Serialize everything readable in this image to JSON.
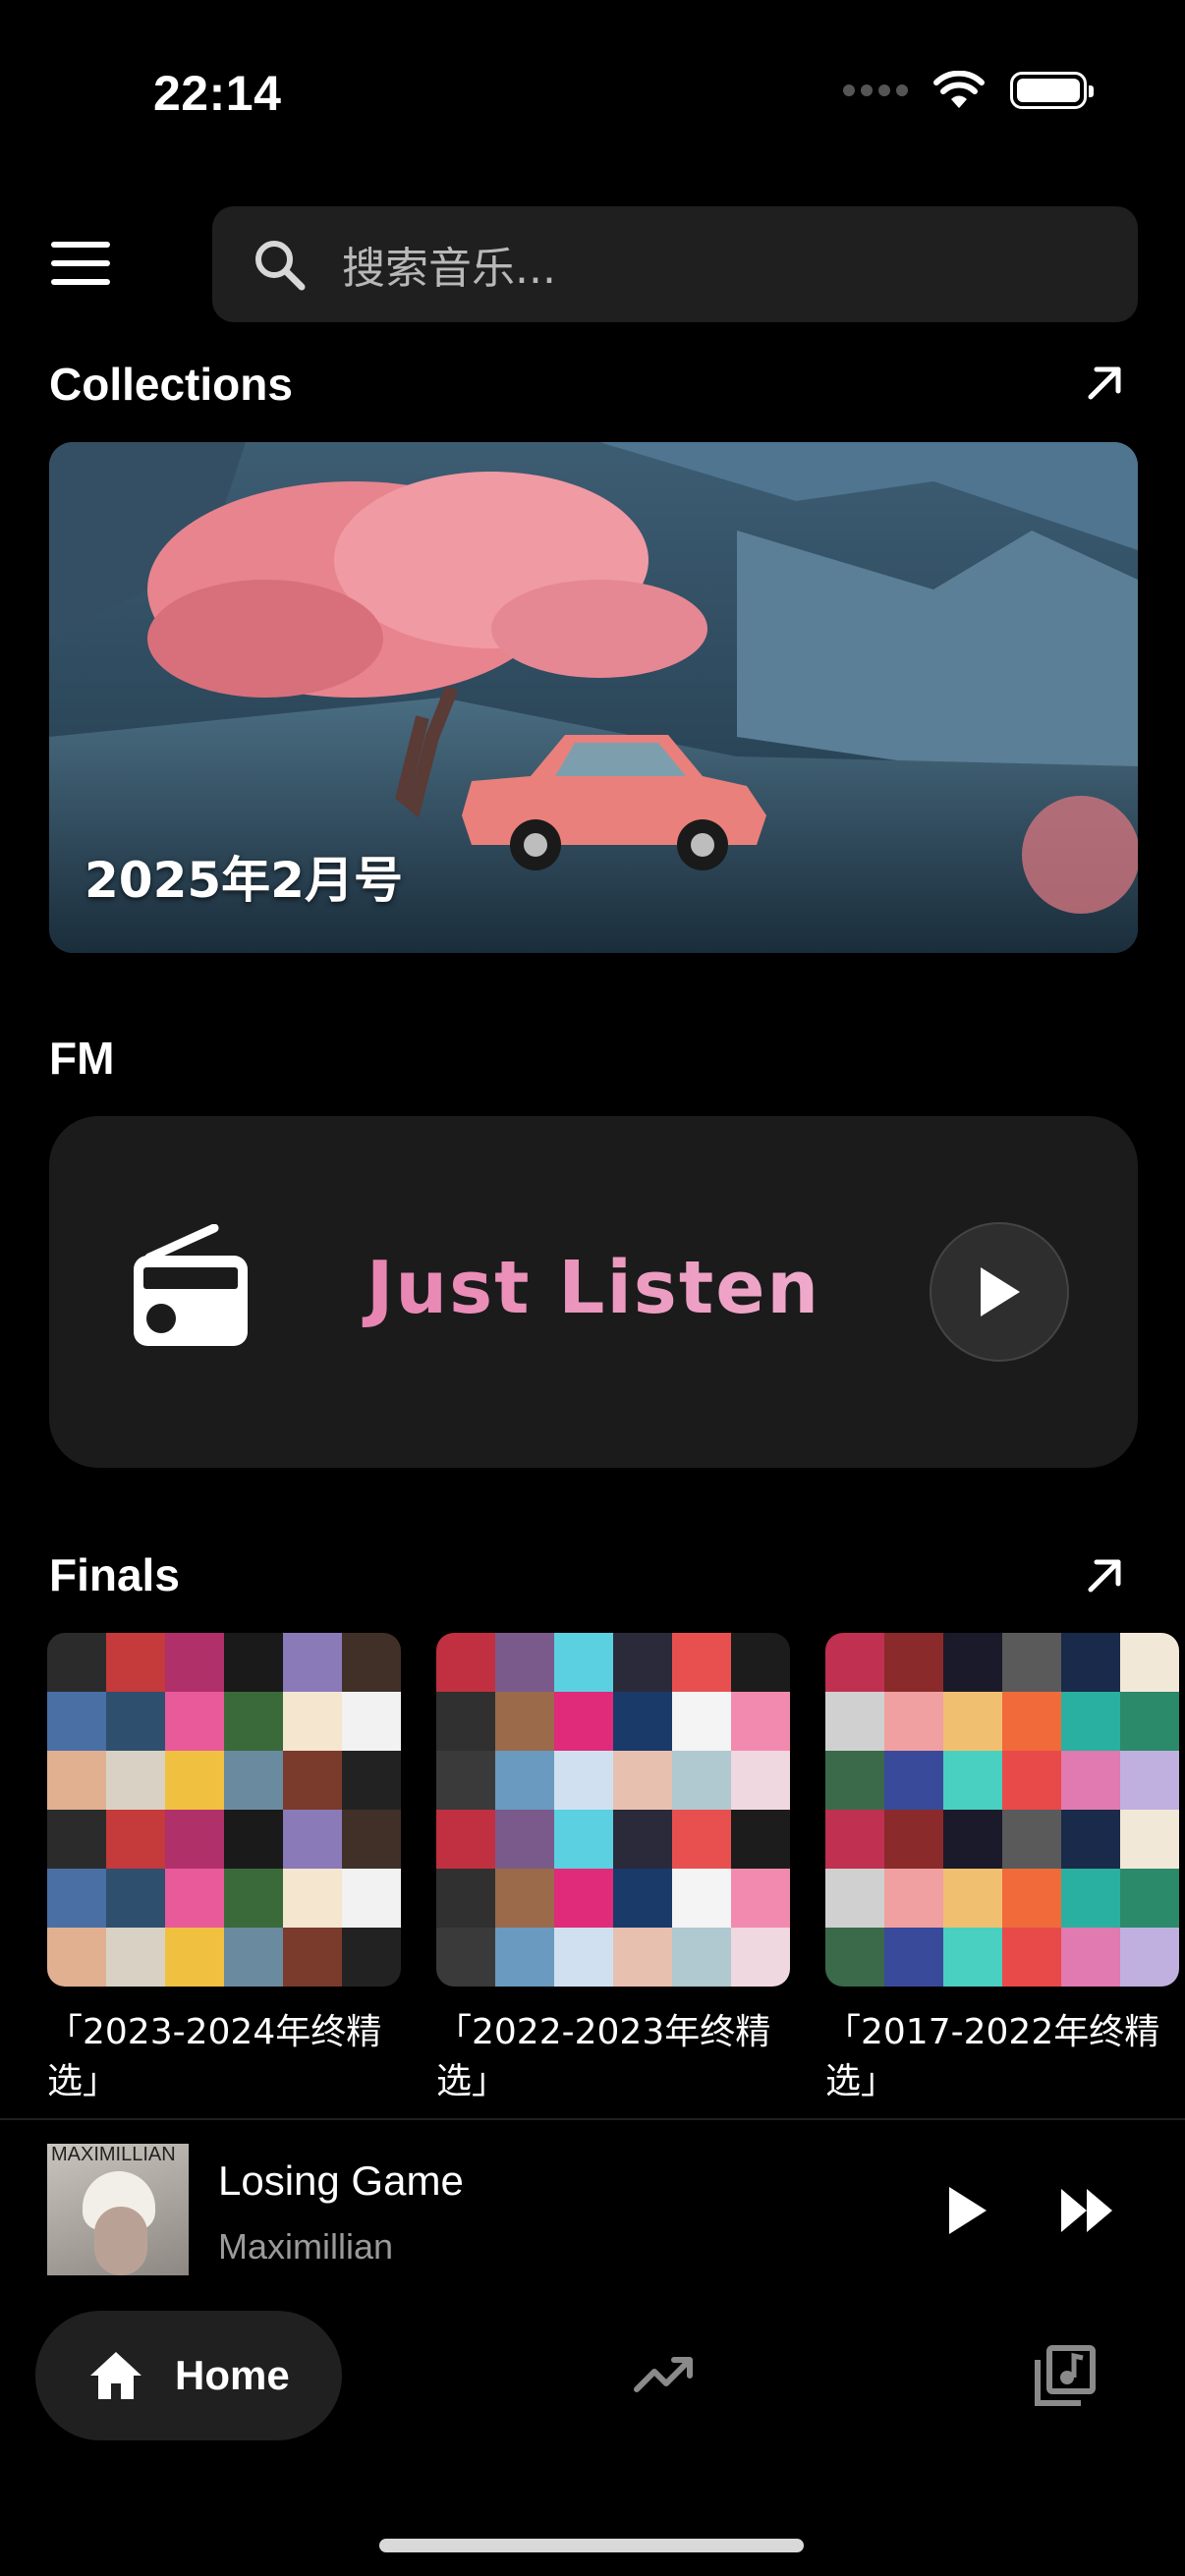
{
  "status_bar": {
    "time": "22:14"
  },
  "search": {
    "placeholder": "搜索音乐..."
  },
  "collections": {
    "title": "Collections",
    "banner_label": "2025年2月号"
  },
  "fm": {
    "title": "FM",
    "card_title": "Just Listen"
  },
  "finals": {
    "title": "Finals",
    "albums": [
      {
        "title": "「2023-2024年终精选」"
      },
      {
        "title": "「2022-2023年终精选」"
      },
      {
        "title": "「2017-2022年终精选」"
      }
    ]
  },
  "now_playing": {
    "title": "Losing Game",
    "artist": "Maximillian",
    "art_caption": "MAXIMILLIAN"
  },
  "nav": {
    "home_label": "Home"
  },
  "colors": {
    "accent_pink": "#e36aa0",
    "card_bg": "#1b1b1b",
    "background": "#000000"
  }
}
